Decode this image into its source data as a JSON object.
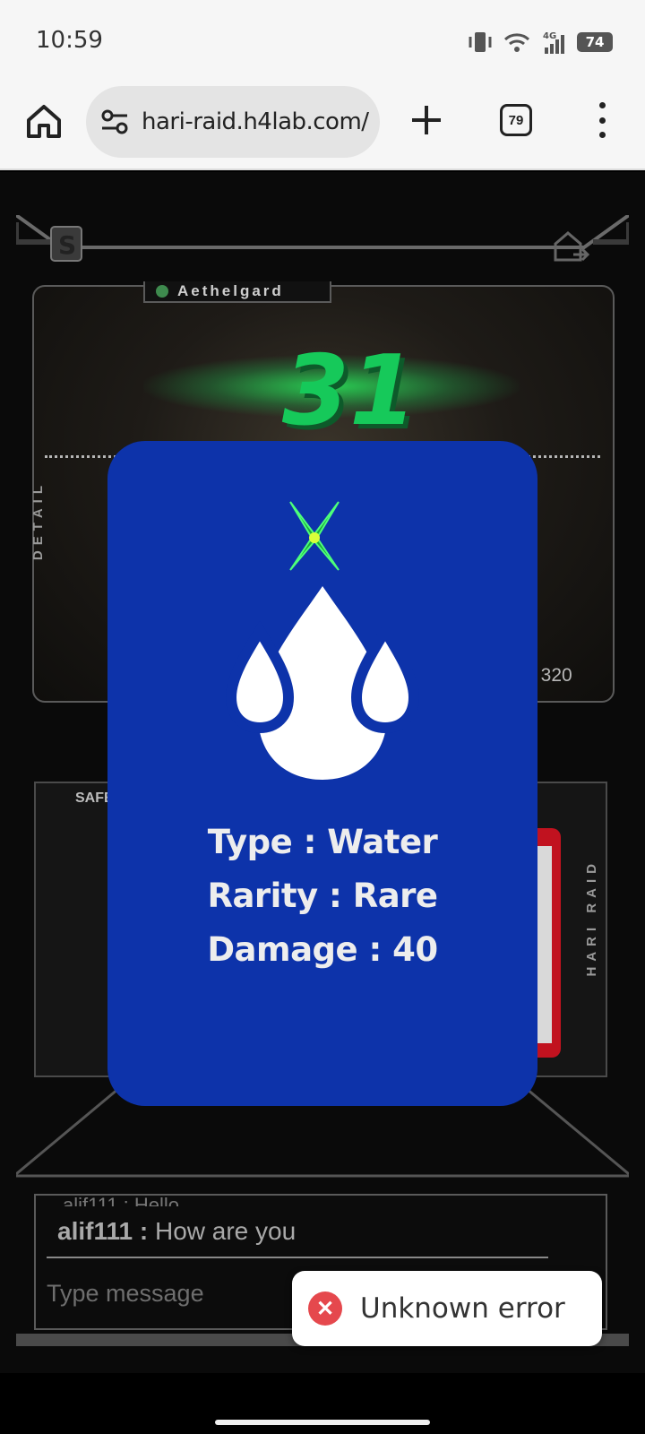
{
  "status_bar": {
    "time": "10:59",
    "network": "4G",
    "battery": "74"
  },
  "browser": {
    "url": "hari-raid.h4lab.com/",
    "tab_count": "79"
  },
  "game": {
    "boss_name": "Aethelgard",
    "boss_hp_current": "31",
    "boss_hp_total": "/ 320",
    "detail_label": "DETAIL",
    "side_label": "HARI RAID",
    "safe_label": "SAFE"
  },
  "card": {
    "icon": "water-drops-icon",
    "type_line": "Type : Water",
    "rarity_line": "Rarity : Rare",
    "damage_line": "Damage : 40",
    "color": "#0d33aa"
  },
  "chat": {
    "previous_message": "alif111 : Hello",
    "last_user": "alif111 :",
    "last_message": "How are you",
    "input_placeholder": "Type message"
  },
  "toast": {
    "message": "Unknown error",
    "icon": "error-x-icon",
    "icon_color": "#e5484d"
  }
}
